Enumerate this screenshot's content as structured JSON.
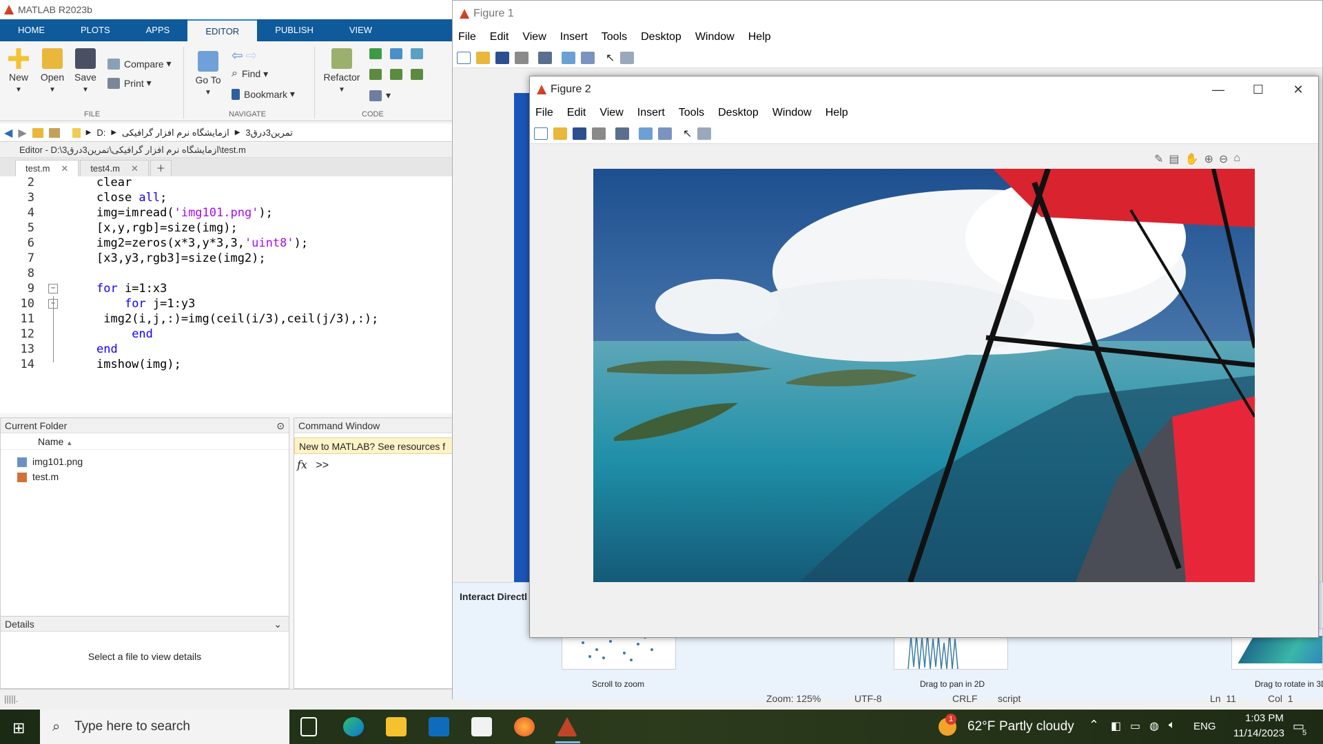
{
  "matlab": {
    "title": "MATLAB R2023b",
    "tabs": [
      "HOME",
      "PLOTS",
      "APPS",
      "EDITOR",
      "PUBLISH",
      "VIEW"
    ],
    "active_tab": "EDITOR",
    "file_group": {
      "label": "FILE",
      "new": "New",
      "open": "Open",
      "save": "Save",
      "compare": "Compare",
      "print": "Print"
    },
    "navigate_group": {
      "label": "NAVIGATE",
      "goto": "Go To",
      "find": "Find",
      "bookmark": "Bookmark"
    },
    "code_group": {
      "label": "CODE",
      "refactor": "Refactor"
    },
    "address": {
      "drive": "D:",
      "folder1": "ازمایشگاه نرم افزار گرافیکی",
      "folder2": "تمرین3درق3"
    },
    "editor_title": "Editor - D:\\ازمایشگاه نرم افزار گرافیکی\\تمرین3درق3\\test.m",
    "editor_tabs": [
      {
        "label": "test.m"
      },
      {
        "label": "test4.m"
      }
    ],
    "code_lines": [
      {
        "n": "2",
        "html": "clear"
      },
      {
        "n": "3",
        "html": "close all;"
      },
      {
        "n": "4",
        "html": "img=imread('img101.png');"
      },
      {
        "n": "5",
        "html": "[x,y,rgb]=size(img);"
      },
      {
        "n": "6",
        "html": "img2=zeros(x*3,y*3,3,'uint8');"
      },
      {
        "n": "7",
        "html": "[x3,y3,rgb3]=size(img2);"
      },
      {
        "n": "8",
        "html": ""
      },
      {
        "n": "9",
        "html": "for i=1:x3"
      },
      {
        "n": "10",
        "html": "    for j=1:y3"
      },
      {
        "n": "11",
        "html": " img2(i,j,:)=img(ceil(i/3),ceil(j/3),:);"
      },
      {
        "n": "12",
        "html": "     end"
      },
      {
        "n": "13",
        "html": "end"
      },
      {
        "n": "14",
        "html": "imshow(img);"
      }
    ],
    "current_folder": {
      "title": "Current Folder",
      "column": "Name",
      "files": [
        "img101.png",
        "test.m"
      ]
    },
    "details": {
      "title": "Details",
      "message": "Select a file to view details"
    },
    "command_window": {
      "title": "Command Window",
      "banner": "New to MATLAB? See resources f",
      "prompt": ">>"
    }
  },
  "figure1": {
    "title": "Figure 1",
    "menu": [
      "File",
      "Edit",
      "View",
      "Insert",
      "Tools",
      "Desktop",
      "Window",
      "Help"
    ],
    "interact": {
      "title": "Interact Directl",
      "scroll": "Scroll to zoom",
      "pan": "Drag to pan in 2D",
      "rotate": "Drag to rotate in 3D"
    },
    "status": {
      "zoom": "Zoom: 125%",
      "encoding": "UTF-8",
      "eol": "CRLF",
      "type": "script",
      "ln": "Ln  11",
      "col": "Col  1"
    }
  },
  "figure2": {
    "title": "Figure 2",
    "menu": [
      "File",
      "Edit",
      "View",
      "Insert",
      "Tools",
      "Desktop",
      "Window",
      "Help"
    ]
  },
  "taskbar": {
    "search_placeholder": "Type here to search",
    "weather_temp": "62°F",
    "weather_text": "Partly cloudy",
    "weather_badge": "1",
    "lang": "ENG",
    "time": "1:03 PM",
    "date": "11/14/2023",
    "notifications": "5"
  }
}
